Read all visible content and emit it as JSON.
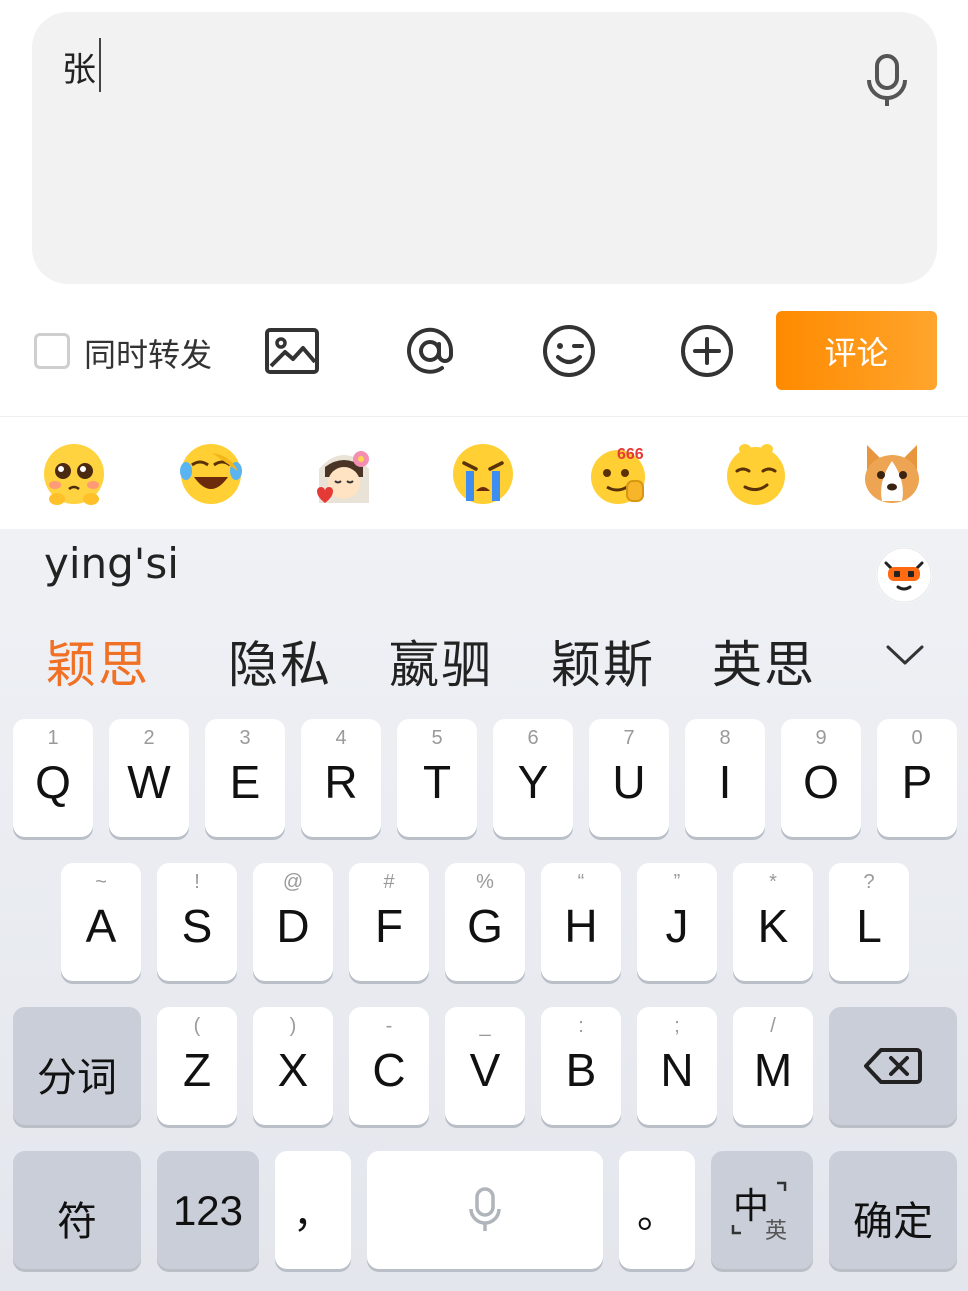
{
  "composer": {
    "input_value": "张",
    "repost_label": "同时转发",
    "comment_button": "评论"
  },
  "emojis": [
    "pleading-face",
    "laughing-tears",
    "bride",
    "crying",
    "666-thumbs",
    "smug-face",
    "corgi"
  ],
  "ime": {
    "pinyin": "ying'si",
    "candidates": [
      "颖思",
      "隐私",
      "嬴驷",
      "颖斯",
      "英思"
    ]
  },
  "keyboard": {
    "row1": [
      {
        "letter": "Q",
        "hint": "1"
      },
      {
        "letter": "W",
        "hint": "2"
      },
      {
        "letter": "E",
        "hint": "3"
      },
      {
        "letter": "R",
        "hint": "4"
      },
      {
        "letter": "T",
        "hint": "5"
      },
      {
        "letter": "Y",
        "hint": "6"
      },
      {
        "letter": "U",
        "hint": "7"
      },
      {
        "letter": "I",
        "hint": "8"
      },
      {
        "letter": "O",
        "hint": "9"
      },
      {
        "letter": "P",
        "hint": "0"
      }
    ],
    "row2": [
      {
        "letter": "A",
        "hint": "~"
      },
      {
        "letter": "S",
        "hint": "!"
      },
      {
        "letter": "D",
        "hint": "@"
      },
      {
        "letter": "F",
        "hint": "#"
      },
      {
        "letter": "G",
        "hint": "%"
      },
      {
        "letter": "H",
        "hint": "“"
      },
      {
        "letter": "J",
        "hint": "”"
      },
      {
        "letter": "K",
        "hint": "*"
      },
      {
        "letter": "L",
        "hint": "?"
      }
    ],
    "row3": [
      {
        "letter": "Z",
        "hint": "("
      },
      {
        "letter": "X",
        "hint": ")"
      },
      {
        "letter": "C",
        "hint": "-"
      },
      {
        "letter": "V",
        "hint": "_"
      },
      {
        "letter": "B",
        "hint": ":"
      },
      {
        "letter": "N",
        "hint": ";"
      },
      {
        "letter": "M",
        "hint": "/"
      }
    ],
    "segment_key": "分词",
    "symbol_key": "符",
    "number_key": "123",
    "comma_key": "，",
    "period_key": "。",
    "lang_key_main": "中",
    "lang_key_sub": "英",
    "confirm_key": "确定"
  },
  "colors": {
    "accent": "#ff8a00",
    "candidate_highlight": "#f07025",
    "input_bg": "#f2f2f2",
    "fn_key_bg": "#c9ced8"
  }
}
